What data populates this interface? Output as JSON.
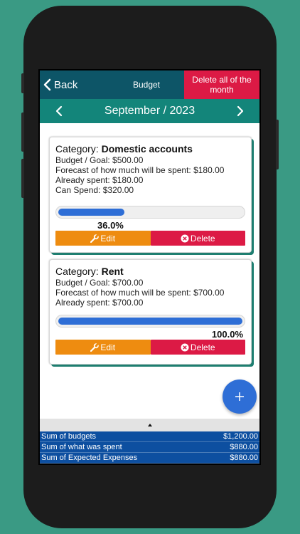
{
  "header": {
    "back_label": "Back",
    "title": "Budget",
    "delete_month_label": "Delete all of the month"
  },
  "month": {
    "label": "September / 2023"
  },
  "cards": [
    {
      "category_prefix": "Category: ",
      "category_name": "Domestic accounts",
      "budget": "Budget / Goal: $500.00",
      "forecast": "Forecast of how much will be spent: $180.00",
      "spent": "Already spent: $180.00",
      "can_spend": "Can Spend: $320.00",
      "progress": 0.36,
      "percent_label": "36.0%",
      "edit_label": "Edit",
      "delete_label": "Delete"
    },
    {
      "category_prefix": "Category: ",
      "category_name": "Rent",
      "budget": "Budget / Goal: $700.00",
      "forecast": "Forecast of how much will be spent: $700.00",
      "spent": "Already spent: $700.00",
      "progress": 1.0,
      "percent_label": "100.0%",
      "edit_label": "Edit",
      "delete_label": "Delete"
    }
  ],
  "summary": {
    "rows": [
      {
        "label": "Sum of budgets",
        "value": "$1,200.00"
      },
      {
        "label": "Sum of what was spent",
        "value": "$880.00"
      },
      {
        "label": "Sum of Expected Expenses",
        "value": "$880.00"
      }
    ]
  },
  "colors": {
    "background": "#3a9a84",
    "header": "#0d5567",
    "month_bar": "#13857a",
    "danger": "#dc1a45",
    "edit": "#ee8c10",
    "progress": "#2e6ed6",
    "summary": "#0d4fa0"
  },
  "icons": {
    "back": "chevron-left-icon",
    "prev_month": "chevron-left-icon",
    "next_month": "chevron-right-icon",
    "edit": "wrench-icon",
    "delete": "x-circle-icon",
    "add": "plus-icon",
    "collapse": "caret-up-icon"
  }
}
